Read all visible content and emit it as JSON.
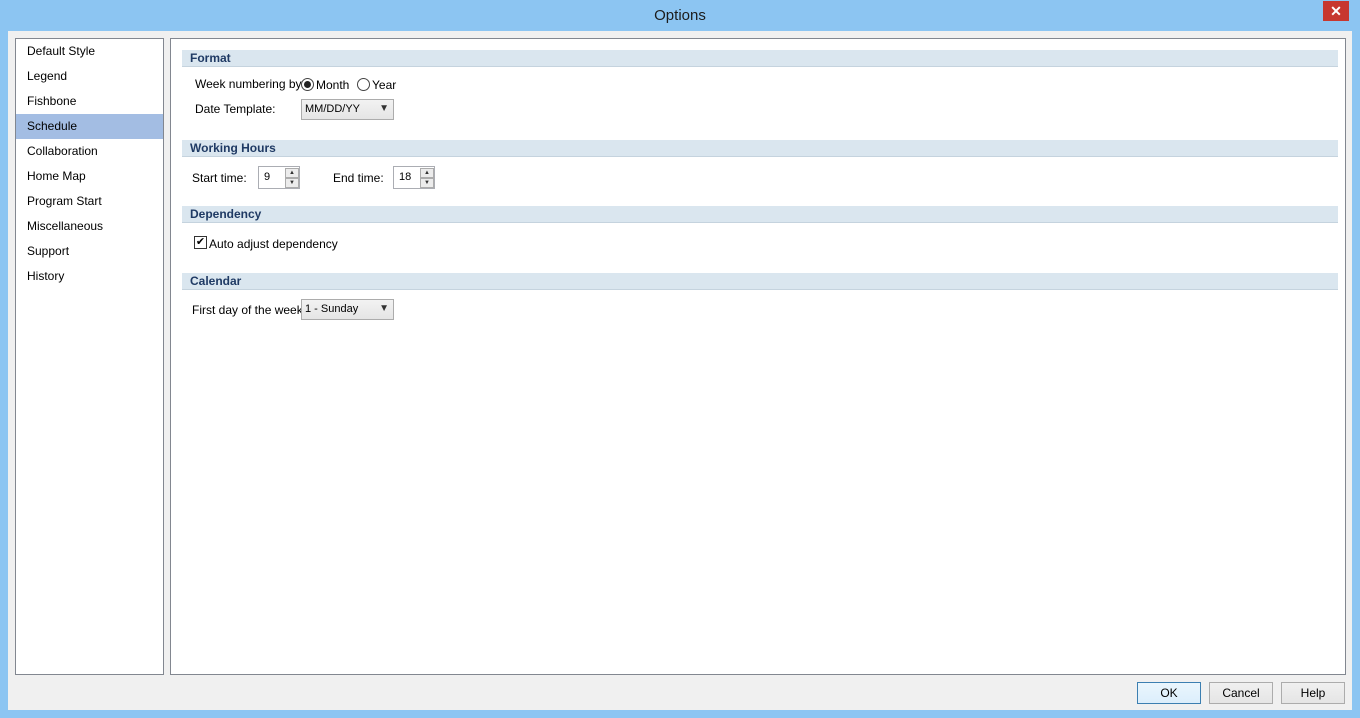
{
  "window": {
    "title": "Options",
    "close_glyph": "✕"
  },
  "sidebar": {
    "items": [
      {
        "label": "Default Style"
      },
      {
        "label": "Legend"
      },
      {
        "label": "Fishbone"
      },
      {
        "label": "Schedule",
        "selected": true
      },
      {
        "label": "Collaboration"
      },
      {
        "label": "Home Map"
      },
      {
        "label": "Program Start"
      },
      {
        "label": "Miscellaneous"
      },
      {
        "label": "Support"
      },
      {
        "label": "History"
      }
    ]
  },
  "format": {
    "header": "Format",
    "week_numbering_label": "Week numbering by",
    "month_label": "Month",
    "year_label": "Year",
    "week_numbering_selected": "Month",
    "date_template_label": "Date Template:",
    "date_template_value": "MM/DD/YY"
  },
  "working_hours": {
    "header": "Working Hours",
    "start_label": "Start time:",
    "start_value": "9",
    "end_label": "End time:",
    "end_value": "18"
  },
  "dependency": {
    "header": "Dependency",
    "auto_adjust_label": "Auto adjust dependency",
    "auto_adjust_checked": true,
    "check_glyph": "✔"
  },
  "calendar": {
    "header": "Calendar",
    "first_day_label": "First day of the week:",
    "first_day_value": "1 - Sunday"
  },
  "buttons": {
    "ok": "OK",
    "cancel": "Cancel",
    "help": "Help"
  },
  "colors": {
    "titlebar": "#8cc5f2",
    "selection": "#a3bde3",
    "section_header": "#dae6ef",
    "section_text": "#1f3a64"
  }
}
